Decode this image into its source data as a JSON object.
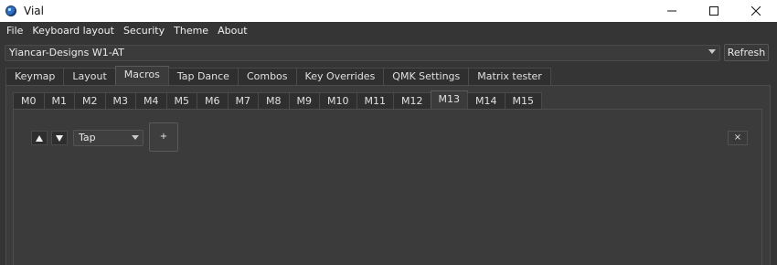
{
  "window": {
    "title": "Vial",
    "icon": "vial-logo-icon",
    "controls": [
      "minimize",
      "maximize",
      "close"
    ]
  },
  "menu": [
    "File",
    "Keyboard layout",
    "Security",
    "Theme",
    "About"
  ],
  "keyboard": {
    "selected": "Yiancar-Designs W1-AT",
    "refresh_label": "Refresh"
  },
  "main_tabs": {
    "items": [
      "Keymap",
      "Layout",
      "Macros",
      "Tap Dance",
      "Combos",
      "Key Overrides",
      "QMK Settings",
      "Matrix tester"
    ],
    "active": "Macros"
  },
  "macro_tabs": {
    "items": [
      "M0",
      "M1",
      "M2",
      "M3",
      "M4",
      "M5",
      "M6",
      "M7",
      "M8",
      "M9",
      "M10",
      "M11",
      "M12",
      "M13",
      "M14",
      "M15"
    ],
    "active": "M13"
  },
  "macro_editor": {
    "action_type": "Tap",
    "add_label": "+",
    "remove_label": "×"
  },
  "colors": {
    "background": "#353535",
    "panel": "#3b3b3b",
    "text": "#e0e0e0"
  }
}
